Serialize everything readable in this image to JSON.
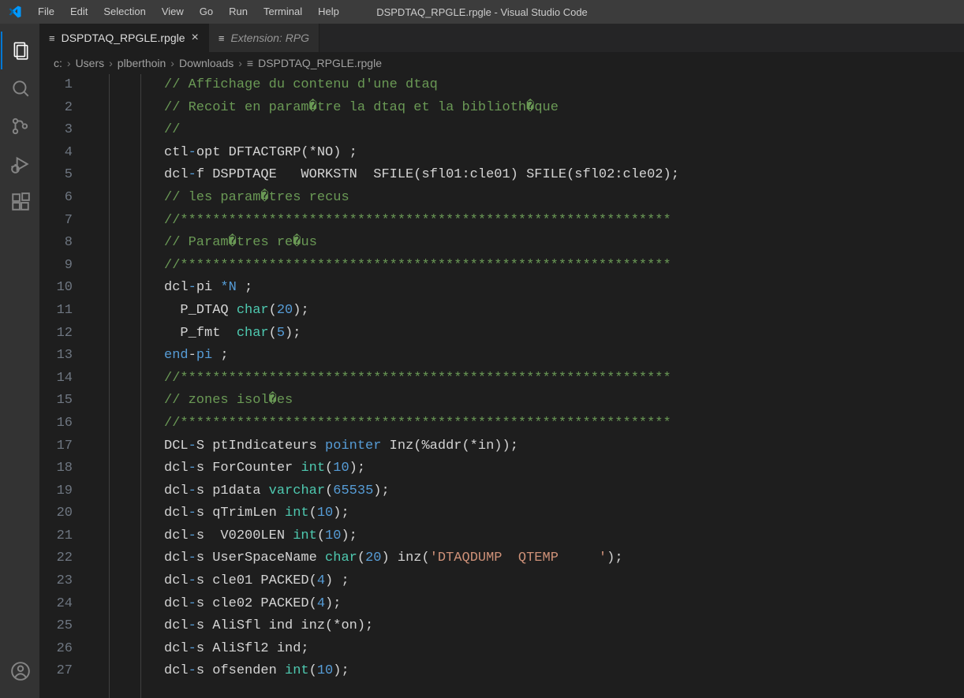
{
  "window_title": "DSPDTAQ_RPGLE.rpgle - Visual Studio Code",
  "menu": [
    "File",
    "Edit",
    "Selection",
    "View",
    "Go",
    "Run",
    "Terminal",
    "Help"
  ],
  "tabs": [
    {
      "label": "DSPDTAQ_RPGLE.rpgle",
      "active": true,
      "closeable": true
    },
    {
      "label": "Extension: RPG",
      "active": false,
      "closeable": false
    }
  ],
  "breadcrumbs": [
    "c:",
    "Users",
    "plberthoin",
    "Downloads",
    "DSPDTAQ_RPGLE.rpgle"
  ],
  "first_line": 1,
  "code": [
    [
      [
        "comment",
        "// Affichage du contenu d'une dtaq"
      ]
    ],
    [
      [
        "comment",
        "// Recoit en param�tre la dtaq et la biblioth�que"
      ]
    ],
    [
      [
        "comment",
        "//"
      ]
    ],
    [
      [
        "plain",
        "ctl"
      ],
      [
        "kw",
        "-"
      ],
      [
        "plain",
        "opt DFTACTGRP(*NO) ;"
      ]
    ],
    [
      [
        "plain",
        "dcl"
      ],
      [
        "kw",
        "-"
      ],
      [
        "plain",
        "f DSPDTAQE   WORKSTN  SFILE(sfl01:cle01) SFILE(sfl02:cle02);"
      ]
    ],
    [
      [
        "comment",
        "// les param�tres recus"
      ]
    ],
    [
      [
        "comment",
        "//*************************************************************"
      ]
    ],
    [
      [
        "comment",
        "// Param�tres re�us"
      ]
    ],
    [
      [
        "comment",
        "//*************************************************************"
      ]
    ],
    [
      [
        "plain",
        "dcl"
      ],
      [
        "kw",
        "-"
      ],
      [
        "plain",
        "pi "
      ],
      [
        "kw",
        "*N"
      ],
      [
        "plain",
        " ;"
      ]
    ],
    [
      [
        "plain",
        "  P_DTAQ "
      ],
      [
        "type",
        "char"
      ],
      [
        "plain",
        "("
      ],
      [
        "kw",
        "20"
      ],
      [
        "plain",
        ");"
      ]
    ],
    [
      [
        "plain",
        "  P_fmt  "
      ],
      [
        "type",
        "char"
      ],
      [
        "plain",
        "("
      ],
      [
        "kw",
        "5"
      ],
      [
        "plain",
        ");"
      ]
    ],
    [
      [
        "kw",
        "end"
      ],
      [
        "plain",
        "-"
      ],
      [
        "kw",
        "pi"
      ],
      [
        "plain",
        " ;"
      ]
    ],
    [
      [
        "comment",
        "//*************************************************************"
      ]
    ],
    [
      [
        "comment",
        "// zones isol�es"
      ]
    ],
    [
      [
        "comment",
        "//*************************************************************"
      ]
    ],
    [
      [
        "plain",
        "DCL"
      ],
      [
        "kw",
        "-"
      ],
      [
        "plain",
        "S ptIndicateurs "
      ],
      [
        "kw",
        "pointer"
      ],
      [
        "plain",
        " Inz(%addr(*in));"
      ]
    ],
    [
      [
        "plain",
        "dcl"
      ],
      [
        "kw",
        "-"
      ],
      [
        "plain",
        "s ForCounter "
      ],
      [
        "type",
        "int"
      ],
      [
        "plain",
        "("
      ],
      [
        "kw",
        "10"
      ],
      [
        "plain",
        ");"
      ]
    ],
    [
      [
        "plain",
        "dcl"
      ],
      [
        "kw",
        "-"
      ],
      [
        "plain",
        "s p1data "
      ],
      [
        "type",
        "varchar"
      ],
      [
        "plain",
        "("
      ],
      [
        "kw",
        "65535"
      ],
      [
        "plain",
        ");"
      ]
    ],
    [
      [
        "plain",
        "dcl"
      ],
      [
        "kw",
        "-"
      ],
      [
        "plain",
        "s qTrimLen "
      ],
      [
        "type",
        "int"
      ],
      [
        "plain",
        "("
      ],
      [
        "kw",
        "10"
      ],
      [
        "plain",
        ");"
      ]
    ],
    [
      [
        "plain",
        "dcl"
      ],
      [
        "kw",
        "-"
      ],
      [
        "plain",
        "s  V0200LEN "
      ],
      [
        "type",
        "int"
      ],
      [
        "plain",
        "("
      ],
      [
        "kw",
        "10"
      ],
      [
        "plain",
        ");"
      ]
    ],
    [
      [
        "plain",
        "dcl"
      ],
      [
        "kw",
        "-"
      ],
      [
        "plain",
        "s UserSpaceName "
      ],
      [
        "type",
        "char"
      ],
      [
        "plain",
        "("
      ],
      [
        "kw",
        "20"
      ],
      [
        "plain",
        ") inz("
      ],
      [
        "str",
        "'DTAQDUMP  QTEMP     '"
      ],
      [
        "plain",
        ");"
      ]
    ],
    [
      [
        "plain",
        "dcl"
      ],
      [
        "kw",
        "-"
      ],
      [
        "plain",
        "s cle01 PACKED("
      ],
      [
        "kw",
        "4"
      ],
      [
        "plain",
        ") ;"
      ]
    ],
    [
      [
        "plain",
        "dcl"
      ],
      [
        "kw",
        "-"
      ],
      [
        "plain",
        "s cle02 PACKED("
      ],
      [
        "kw",
        "4"
      ],
      [
        "plain",
        ");"
      ]
    ],
    [
      [
        "plain",
        "dcl"
      ],
      [
        "kw",
        "-"
      ],
      [
        "plain",
        "s AliSfl ind inz(*on);"
      ]
    ],
    [
      [
        "plain",
        "dcl"
      ],
      [
        "kw",
        "-"
      ],
      [
        "plain",
        "s AliSfl2 ind;"
      ]
    ],
    [
      [
        "plain",
        "dcl"
      ],
      [
        "kw",
        "-"
      ],
      [
        "plain",
        "s ofsenden "
      ],
      [
        "type",
        "int"
      ],
      [
        "plain",
        "("
      ],
      [
        "kw",
        "10"
      ],
      [
        "plain",
        ");"
      ]
    ]
  ]
}
